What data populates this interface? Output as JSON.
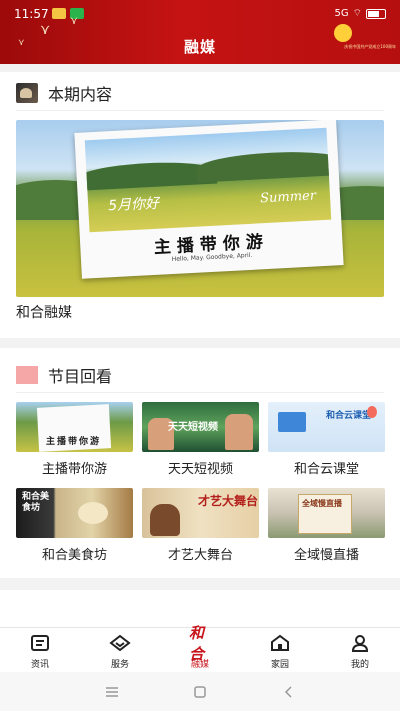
{
  "status_bar": {
    "time": "11:57",
    "network": "5G",
    "battery": ""
  },
  "header": {
    "title": "融媒",
    "emblem_text": "庆祝中国共产党成立100周年"
  },
  "featured": {
    "section_title": "本期内容",
    "banner": {
      "caption": "主播带你游",
      "subtitle": "Hello, May. Goodbye, April.",
      "overlay_left": "5月你好",
      "overlay_right": "Summer"
    },
    "label": "和合融媒"
  },
  "replay": {
    "section_title": "节目回看",
    "items": [
      {
        "label": "主播带你游",
        "thumb_text": "主播带你游"
      },
      {
        "label": "天天短视频",
        "thumb_text": "天天短视频"
      },
      {
        "label": "和合云课堂",
        "thumb_text": "和合云课堂"
      },
      {
        "label": "和合美食坊",
        "thumb_text": "和合美食坊"
      },
      {
        "label": "才艺大舞台",
        "thumb_text": "才艺大舞台"
      },
      {
        "label": "全域慢直播",
        "thumb_text": "全域慢直播"
      }
    ]
  },
  "tabbar": {
    "items": [
      {
        "label": "资讯",
        "icon": "news-icon"
      },
      {
        "label": "服务",
        "icon": "service-icon"
      },
      {
        "label": "融媒",
        "icon": "rongmei-logo-icon"
      },
      {
        "label": "家园",
        "icon": "home-icon"
      },
      {
        "label": "我的",
        "icon": "profile-icon"
      }
    ],
    "active_index": 2
  },
  "colors": {
    "brand_red": "#c8161d",
    "header_red": "#b60f0f",
    "accent_pink": "#f5a6a6"
  }
}
